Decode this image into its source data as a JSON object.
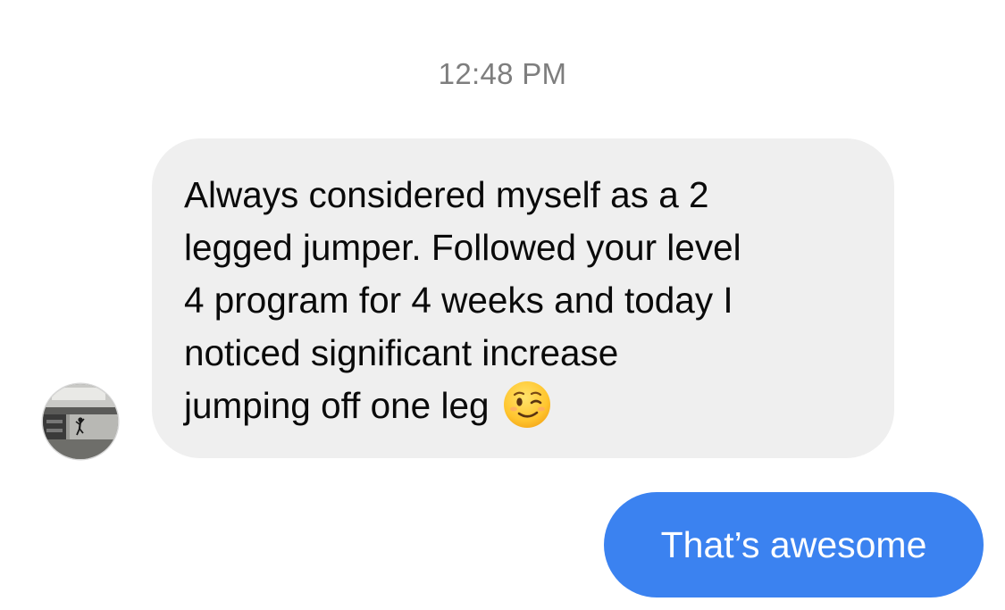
{
  "thread": {
    "timestamp": "12:48 PM"
  },
  "messages": [
    {
      "direction": "incoming",
      "sender_avatar": "profile-photo",
      "lines": [
        "Always considered myself as a 2",
        "legged jumper. Followed your level",
        "4 program for 4 weeks and today I",
        "noticed significant increase",
        "jumping off one leg"
      ],
      "emoji": "winking-face"
    },
    {
      "direction": "outgoing",
      "text": "That’s awesome"
    }
  ],
  "colors": {
    "incoming_bubble": "#efefef",
    "outgoing_bubble": "#3b82f0",
    "timestamp_text": "#7e7e7e",
    "incoming_text": "#0a0a0a",
    "outgoing_text": "#ffffff"
  }
}
